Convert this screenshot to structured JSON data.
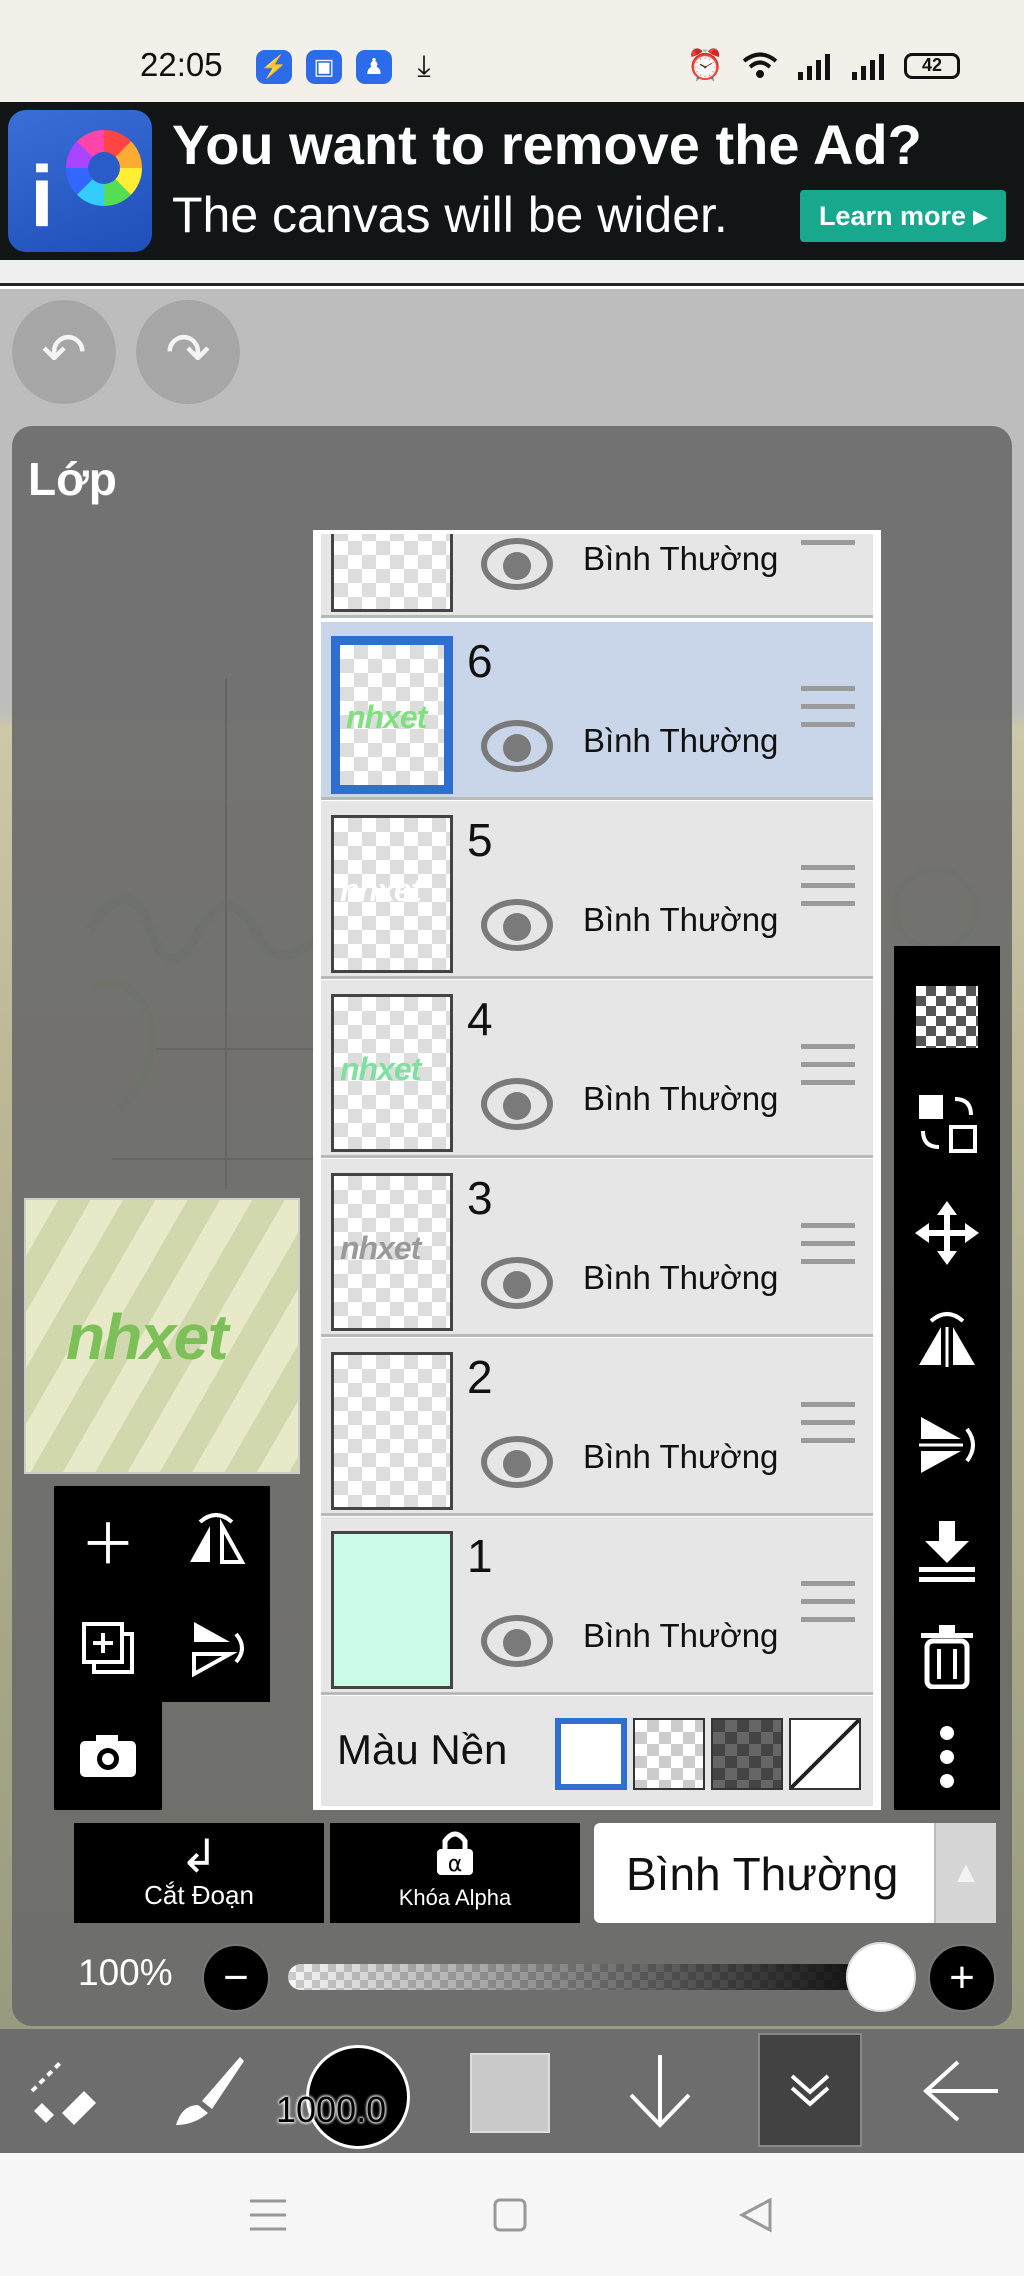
{
  "status_bar": {
    "time": "22:05",
    "left_icons": [
      "messenger-icon",
      "app-icon",
      "app-icon",
      "download-icon"
    ],
    "right_icons": [
      "alarm-icon",
      "wifi-icon",
      "signal-icon",
      "signal-icon"
    ],
    "battery": "42"
  },
  "ad": {
    "logo_letter": "i",
    "headline": "You want to remove the Ad?",
    "subline": "The canvas will be wider.",
    "button": "Learn more ▸"
  },
  "top_controls": {
    "undo": "↶",
    "redo": "↷"
  },
  "panel": {
    "title": "Lớp"
  },
  "preview": {
    "art_text": "nhxet"
  },
  "layers": [
    {
      "number": "",
      "blend": "Bình Thường",
      "visible": true,
      "thumb_text": "",
      "thumb_color": "",
      "fill": ""
    },
    {
      "number": "6",
      "blend": "Bình Thường",
      "visible": true,
      "selected": true,
      "thumb_text": "nhxet",
      "thumb_color": "#7fe07f",
      "fill": ""
    },
    {
      "number": "5",
      "blend": "Bình Thường",
      "visible": true,
      "thumb_text": "nhxet",
      "thumb_color": "#ffffff",
      "fill": ""
    },
    {
      "number": "4",
      "blend": "Bình Thường",
      "visible": true,
      "thumb_text": "nhxet",
      "thumb_color": "#7fe0a0",
      "fill": ""
    },
    {
      "number": "3",
      "blend": "Bình Thường",
      "visible": true,
      "thumb_text": "nhxet",
      "thumb_color": "#9a9a9a",
      "fill": ""
    },
    {
      "number": "2",
      "blend": "Bình Thường",
      "visible": true,
      "thumb_text": "",
      "thumb_color": "",
      "fill": ""
    },
    {
      "number": "1",
      "blend": "Bình Thường",
      "visible": true,
      "thumb_text": "",
      "thumb_color": "",
      "fill": "#ccfbe8"
    }
  ],
  "background": {
    "label": "Màu Nền",
    "selected": "white"
  },
  "left_tools": [
    "add-layer",
    "flip-horizontal",
    "add-copy-layer",
    "flip-vertical",
    "camera"
  ],
  "right_tools": [
    "transparency",
    "swap-layers",
    "move",
    "rotate-flip-horizontal",
    "rotate-flip-vertical",
    "merge-down",
    "delete",
    "more"
  ],
  "controls": {
    "clip_label": "Cắt Đoạn",
    "alpha_lock_label": "Khóa Alpha",
    "blend_mode": "Bình Thường",
    "blend_arrow": "▲"
  },
  "opacity": {
    "label": "100%",
    "value": 1.0,
    "minus": "−",
    "plus": "+"
  },
  "bottom_toolbar": {
    "brush_size": "1000.0",
    "color": "#c9c9c9"
  },
  "colors": {
    "accent": "#2f6fd0",
    "ad_button": "#18a88e",
    "selected_row": "#c9d6ea"
  }
}
